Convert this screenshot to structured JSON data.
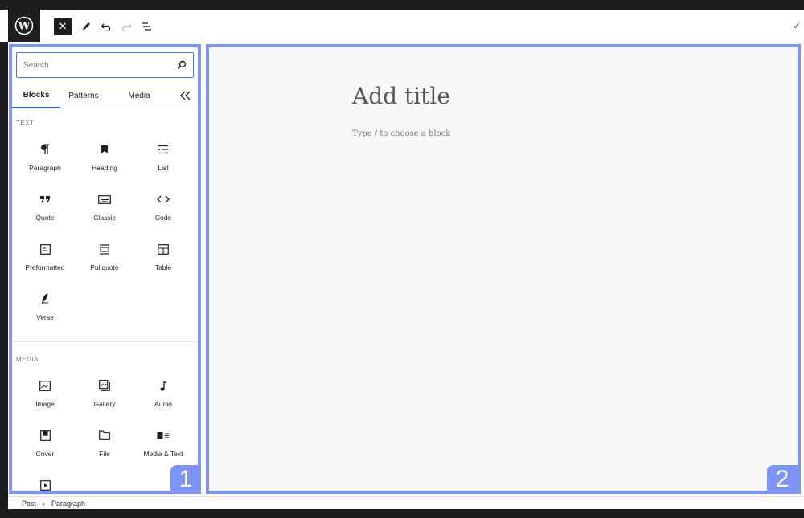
{
  "toolbar": {
    "logo_icon": "wordpress-logo",
    "close_icon": "close-icon",
    "tools_icon": "pencil-icon",
    "undo_icon": "undo-icon",
    "redo_icon": "redo-icon",
    "outline_icon": "list-view-icon",
    "save_icon": "check-icon"
  },
  "inserter": {
    "search_placeholder": "Search",
    "tabs": [
      "Blocks",
      "Patterns",
      "Media"
    ],
    "collapse_icon": "collapse-icon",
    "sections": [
      {
        "label": "TEXT",
        "blocks": [
          {
            "label": "Paragraph",
            "icon": "paragraph-icon"
          },
          {
            "label": "Heading",
            "icon": "heading-icon"
          },
          {
            "label": "List",
            "icon": "list-icon"
          },
          {
            "label": "Quote",
            "icon": "quote-icon"
          },
          {
            "label": "Classic",
            "icon": "keyboard-icon"
          },
          {
            "label": "Code",
            "icon": "code-icon"
          },
          {
            "label": "Preformatted",
            "icon": "preformatted-icon"
          },
          {
            "label": "Pullquote",
            "icon": "pullquote-icon"
          },
          {
            "label": "Table",
            "icon": "table-icon"
          },
          {
            "label": "Verse",
            "icon": "verse-icon"
          }
        ]
      },
      {
        "label": "MEDIA",
        "blocks": [
          {
            "label": "Image",
            "icon": "image-icon"
          },
          {
            "label": "Gallery",
            "icon": "gallery-icon"
          },
          {
            "label": "Audio",
            "icon": "audio-icon"
          },
          {
            "label": "Cover",
            "icon": "cover-icon"
          },
          {
            "label": "File",
            "icon": "file-icon"
          },
          {
            "label": "Media & Text",
            "icon": "media-text-icon"
          },
          {
            "label": "",
            "icon": "video-icon"
          }
        ]
      }
    ]
  },
  "editor": {
    "title_placeholder": "Add title",
    "block_placeholder": "Type / to choose a block"
  },
  "badges": {
    "inserter": "1",
    "canvas": "2"
  },
  "colors": {
    "highlight": "#7d93f5",
    "accent": "#3858e9",
    "dark": "#1e1e1e"
  },
  "breadcrumb": {
    "items": [
      "Post",
      "Paragraph"
    ],
    "separator": "›"
  }
}
